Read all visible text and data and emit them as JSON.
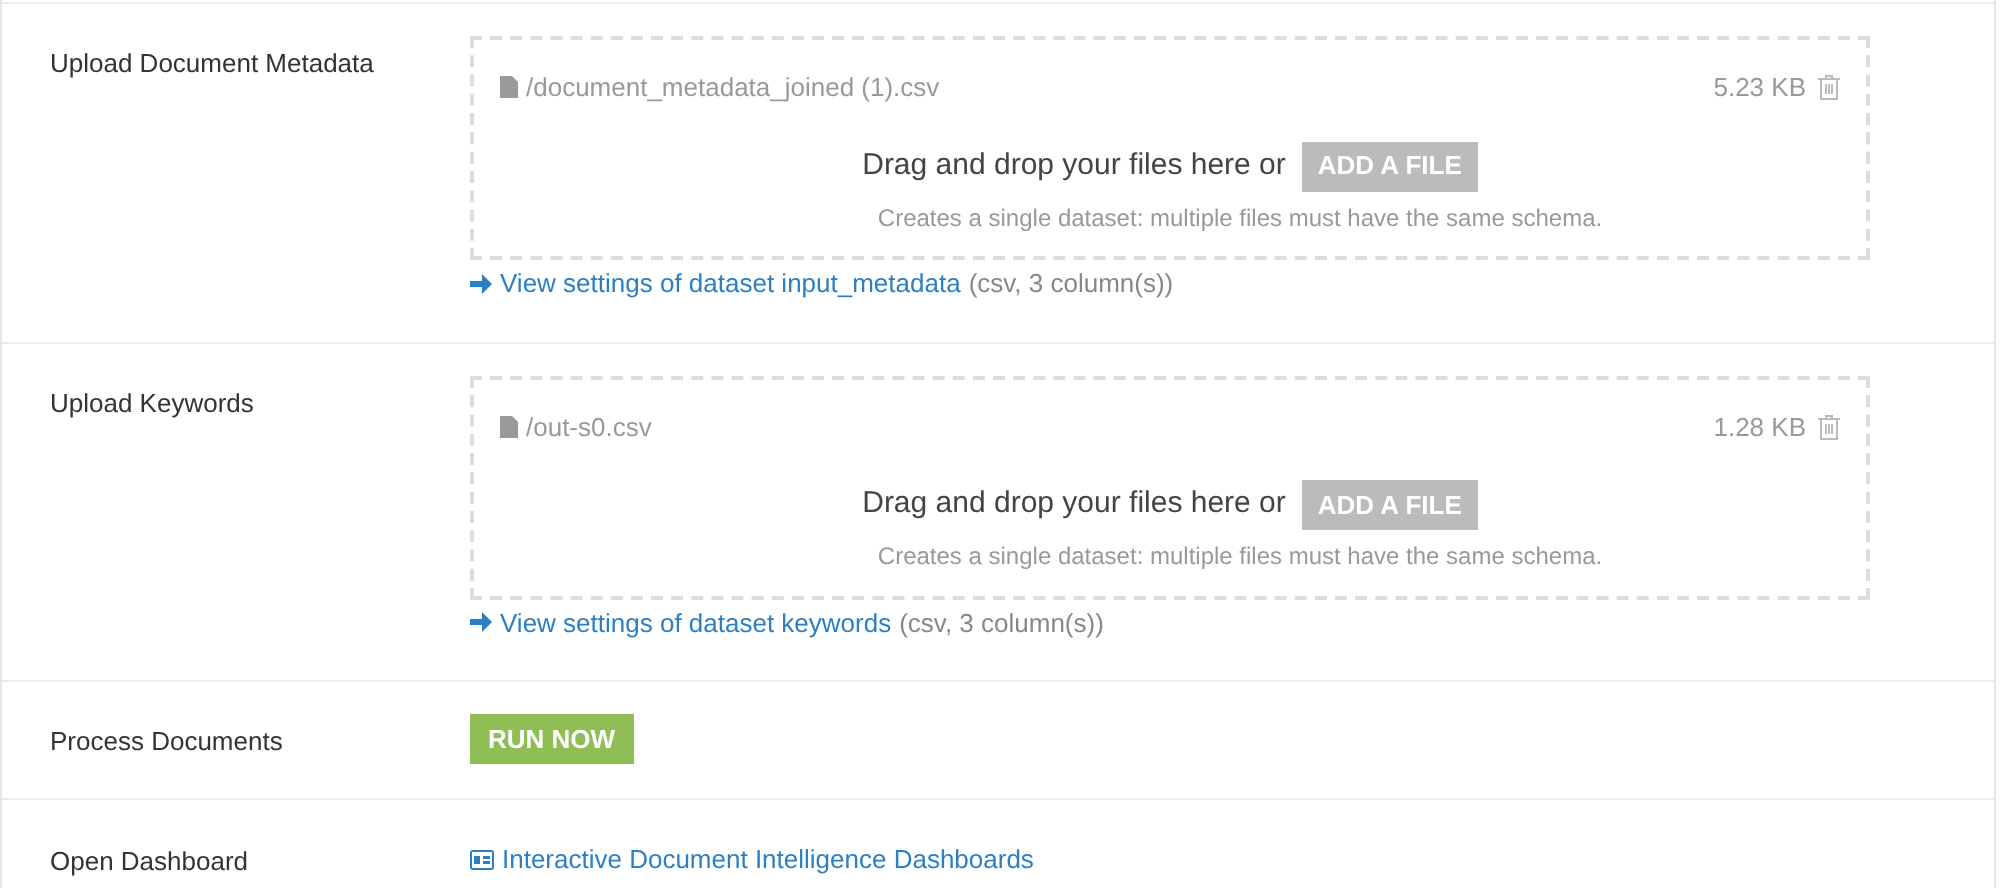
{
  "sections": [
    {
      "kind": "upload",
      "label": "Upload Document Metadata",
      "file": {
        "name": "/document_metadata_joined (1).csv",
        "size": "5.23 KB"
      },
      "drop_text": "Drag and drop your files here or",
      "add_button": "ADD A FILE",
      "hint": "Creates a single dataset: multiple files must have the same schema.",
      "settings_link": "View settings of dataset input_metadata",
      "settings_note": "(csv, 3 column(s))"
    },
    {
      "kind": "upload",
      "label": "Upload Keywords",
      "file": {
        "name": "/out-s0.csv",
        "size": "1.28 KB"
      },
      "drop_text": "Drag and drop your files here or",
      "add_button": "ADD A FILE",
      "hint": "Creates a single dataset: multiple files must have the same schema.",
      "settings_link": "View settings of dataset keywords",
      "settings_note": "(csv, 3 column(s))"
    },
    {
      "kind": "action",
      "label": "Process Documents",
      "button": "RUN NOW"
    },
    {
      "kind": "link",
      "label": "Open Dashboard",
      "link": "Interactive Document Intelligence Dashboards"
    }
  ]
}
